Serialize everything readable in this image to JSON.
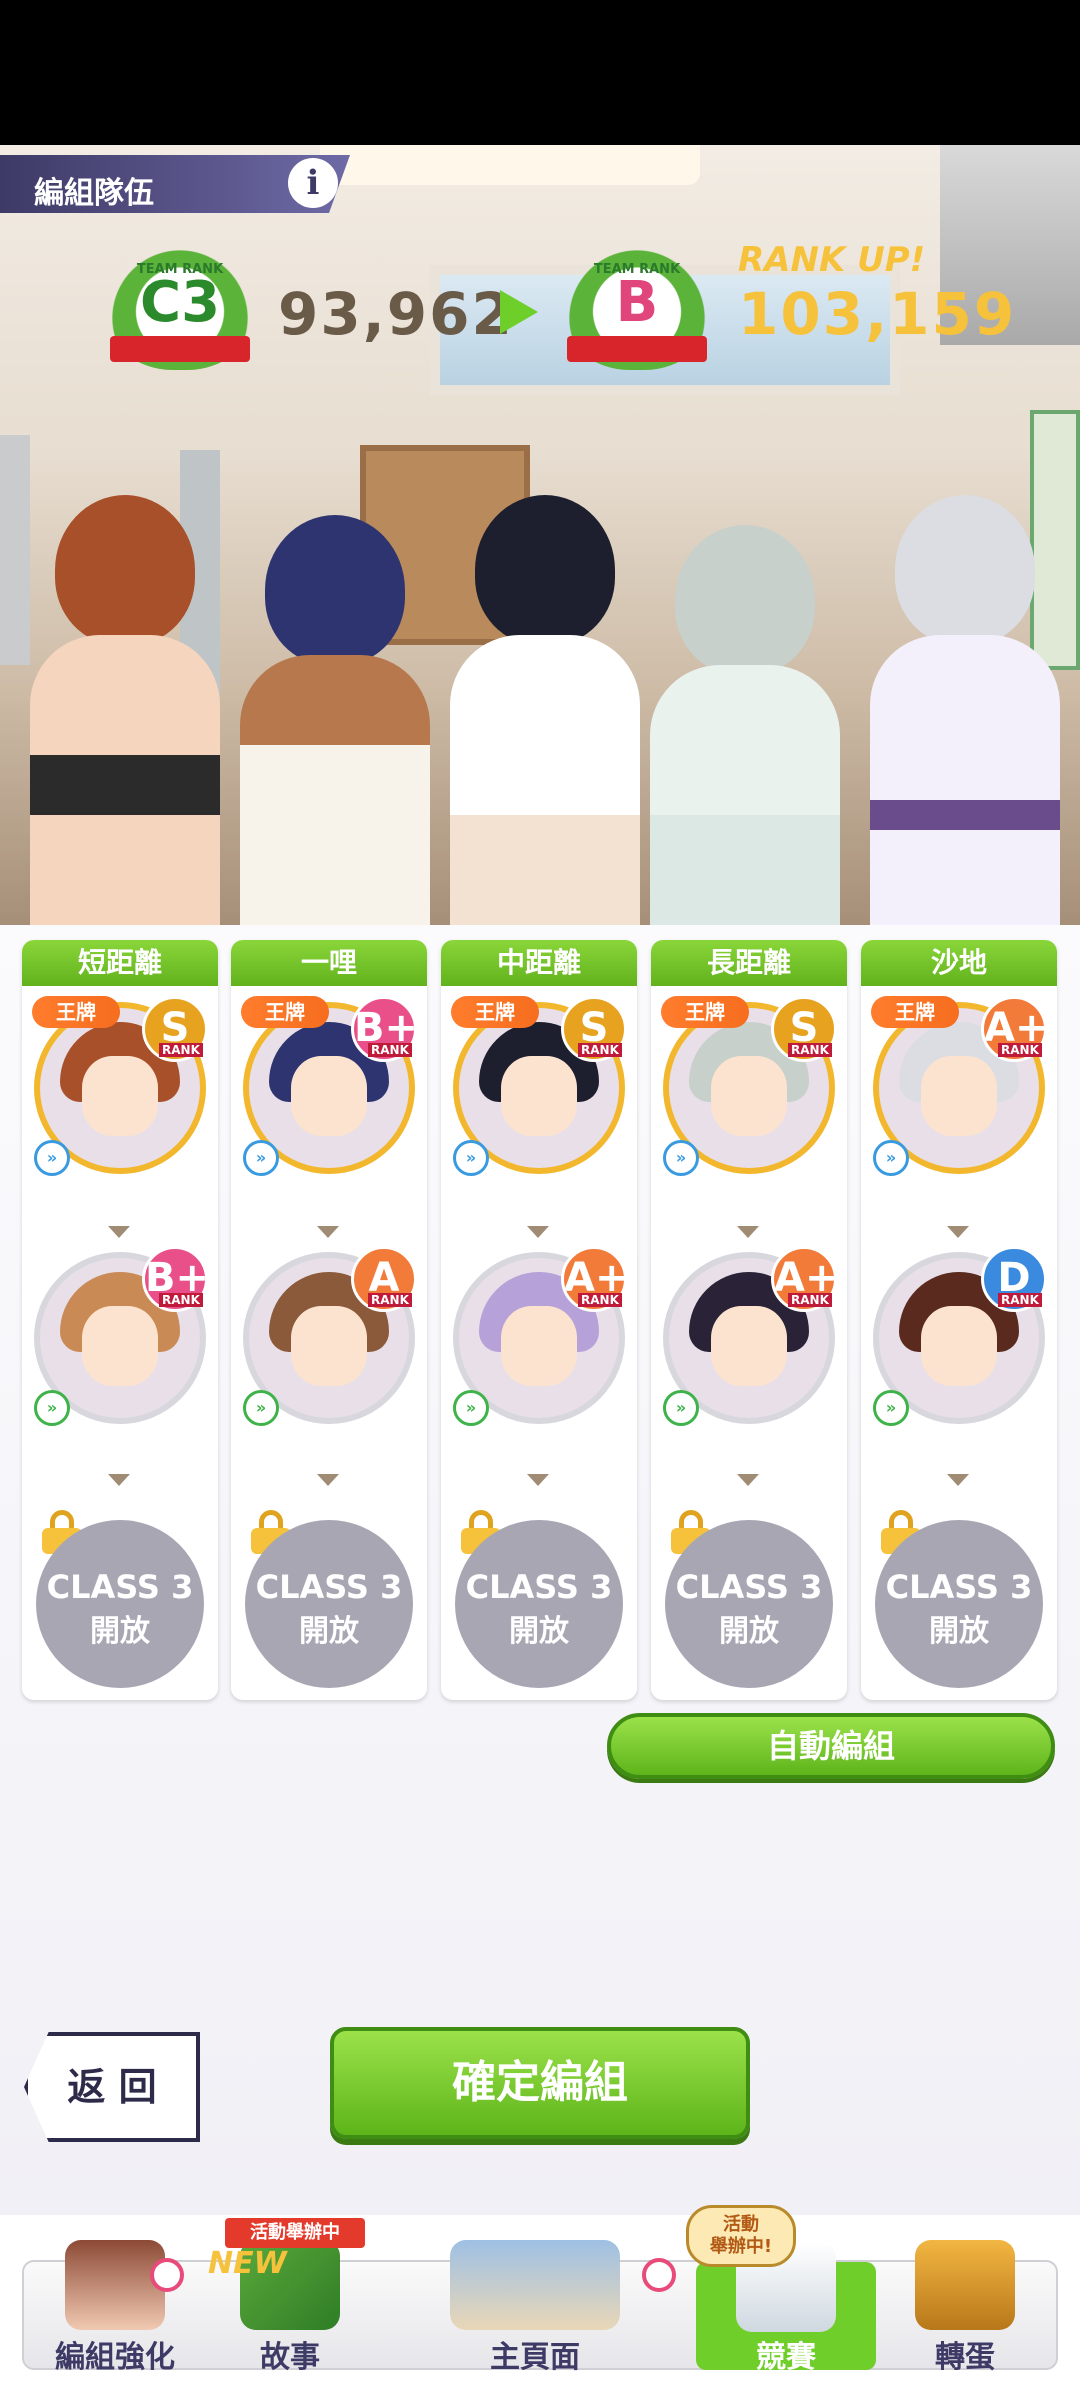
{
  "header": {
    "title": "編組隊伍",
    "info_label": "i"
  },
  "team_rank": {
    "label": "TEAM RANK",
    "current_rank": "C3",
    "current_score": "93,962",
    "next_rank": "B",
    "rank_up_text": "RANK UP!",
    "new_score": "103,159"
  },
  "columns": [
    {
      "title": "短距離",
      "ace": "王牌",
      "ace_rank": "S",
      "sub_rank": "B+",
      "lock_line1": "CLASS 3",
      "lock_line2": "開放"
    },
    {
      "title": "一哩",
      "ace": "王牌",
      "ace_rank": "B+",
      "sub_rank": "A",
      "lock_line1": "CLASS 3",
      "lock_line2": "開放"
    },
    {
      "title": "中距離",
      "ace": "王牌",
      "ace_rank": "S",
      "sub_rank": "A+",
      "lock_line1": "CLASS 3",
      "lock_line2": "開放"
    },
    {
      "title": "長距離",
      "ace": "王牌",
      "ace_rank": "S",
      "sub_rank": "A+",
      "lock_line1": "CLASS 3",
      "lock_line2": "開放"
    },
    {
      "title": "沙地",
      "ace": "王牌",
      "ace_rank": "A+",
      "sub_rank": "D",
      "lock_line1": "CLASS 3",
      "lock_line2": "開放"
    }
  ],
  "rank_label": "RANK",
  "buttons": {
    "auto": "自動編組",
    "back": "返 回",
    "confirm": "確定編組"
  },
  "nav": {
    "items": [
      "編組強化",
      "故事",
      "主頁面",
      "競賽",
      "轉蛋"
    ],
    "event_tag": "活動舉辦中",
    "new_tag": "NEW",
    "event_bubble_1": "活動",
    "event_bubble_2": "舉辦中!"
  },
  "colors": {
    "accent_green": "#6fce2a",
    "rank_gold": "#f6c23c",
    "title_bar": "#3e3a66"
  }
}
